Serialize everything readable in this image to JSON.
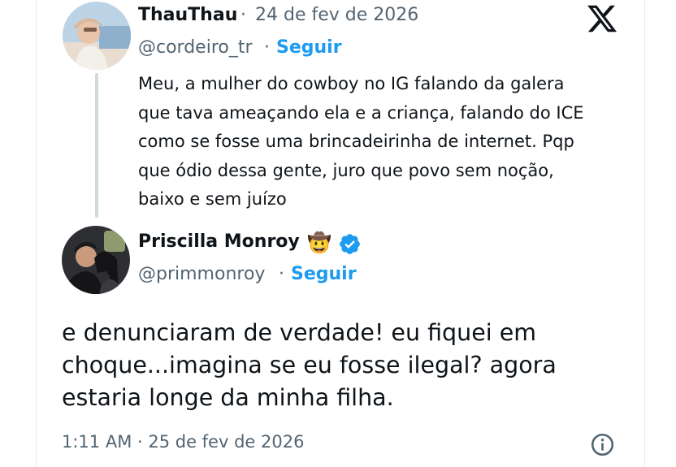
{
  "reply_tweet": {
    "author_name": "ThauThau",
    "separator": "·",
    "date": "24 de fev de 2026",
    "handle": "@cordeiro_tr",
    "handle_separator": "·",
    "follow_label": "Seguir",
    "text": "Meu, a mulher do cowboy no IG falando da galera\nque tava ameaçando ela e a criança, falando do ICE\ncomo se fosse uma brincadeirinha de internet. Pqp\nque ódio dessa gente, juro que povo sem noção,\nbaixo e sem juízo"
  },
  "main_tweet": {
    "author_name": "Priscilla Monroy",
    "emoji": "🤠",
    "verified_icon": "verified-badge-icon",
    "handle": "@primmonroy",
    "handle_separator": "·",
    "follow_label": "Seguir",
    "text": "e denunciaram de verdade! eu fiquei em\nchoque...imagina se eu fosse ilegal? agora\nestaria longe da minha filha.",
    "timestamp": "1:11 AM · 25 de fev de 2026",
    "info_icon": "info-icon"
  },
  "logo": "x-logo-icon",
  "colors": {
    "link": "#1d9bf0",
    "secondary_text": "#536471",
    "primary_text": "#0f1419",
    "thread_line": "#cfd9de",
    "verified": "#1d9bf0"
  }
}
